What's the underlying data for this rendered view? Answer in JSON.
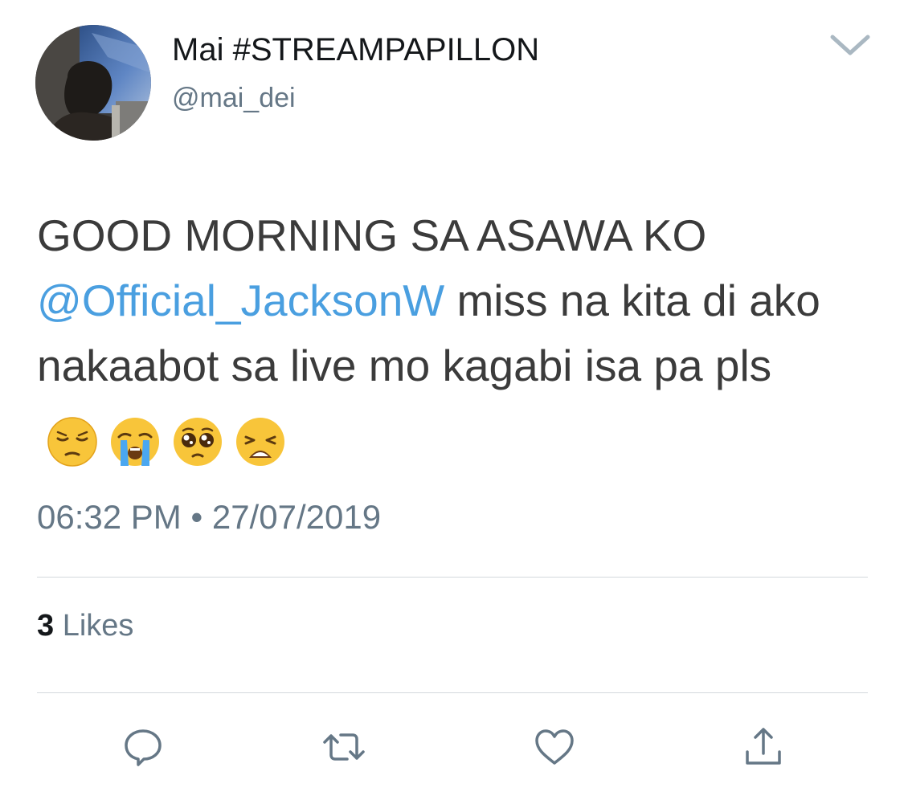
{
  "author": {
    "display_name": "Mai #STREAMPAPILLON",
    "handle": "@mai_dei"
  },
  "tweet": {
    "text_before": "GOOD MORNING SA ASAWA KO ",
    "mention": "@Official_JacksonW",
    "text_after": " miss na kita di ako nakaabot sa live mo kagabi isa pa pls",
    "emojis": [
      "pensive-face",
      "loudly-crying-face",
      "pleading-face",
      "weary-face"
    ]
  },
  "meta": {
    "time": "06:32 PM",
    "separator": "•",
    "date": "27/07/2019"
  },
  "stats": {
    "likes_count": "3",
    "likes_label": "Likes"
  },
  "actions": [
    "reply-icon",
    "retweet-icon",
    "like-icon",
    "share-icon"
  ],
  "colors": {
    "mention": "#4a9fe0",
    "secondary_text": "#657786",
    "divider": "#d4d9dd",
    "icon": "#657786"
  }
}
